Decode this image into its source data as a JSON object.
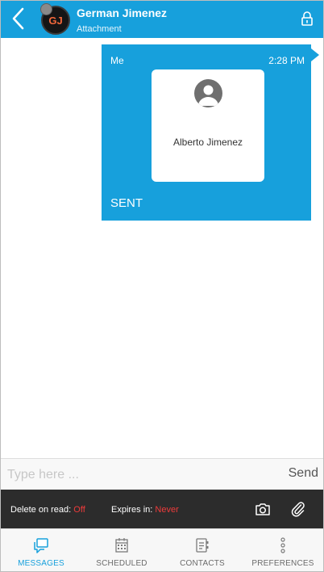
{
  "header": {
    "title": "German Jimenez",
    "subtitle": "Attachment",
    "avatar_initials": "GJ",
    "icons": {
      "back": "back-chevron-icon",
      "lock": "lock-icon"
    }
  },
  "thread": {
    "message": {
      "sender": "Me",
      "time": "2:28 PM",
      "attachment": {
        "type": "contact",
        "name": "Alberto Jimenez",
        "icon": "person-avatar-icon"
      },
      "status": "SENT"
    }
  },
  "composer": {
    "placeholder": "Type here ...",
    "value": "",
    "send_label": "Send"
  },
  "options": {
    "delete_label": "Delete on read:",
    "delete_value": "Off",
    "expires_label": "Expires in:",
    "expires_value": "Never",
    "icons": {
      "camera": "camera-icon",
      "attach": "paperclip-icon"
    }
  },
  "tabs": [
    {
      "label": "MESSAGES",
      "icon": "messages-icon",
      "active": true
    },
    {
      "label": "SCHEDULED",
      "icon": "calendar-icon",
      "active": false
    },
    {
      "label": "CONTACTS",
      "icon": "contacts-icon",
      "active": false
    },
    {
      "label": "PREFERENCES",
      "icon": "more-vertical-icon",
      "active": false
    }
  ],
  "colors": {
    "accent": "#17a0dc",
    "options_bar": "#2c2c2c",
    "warning_text": "#ee3b3b"
  }
}
